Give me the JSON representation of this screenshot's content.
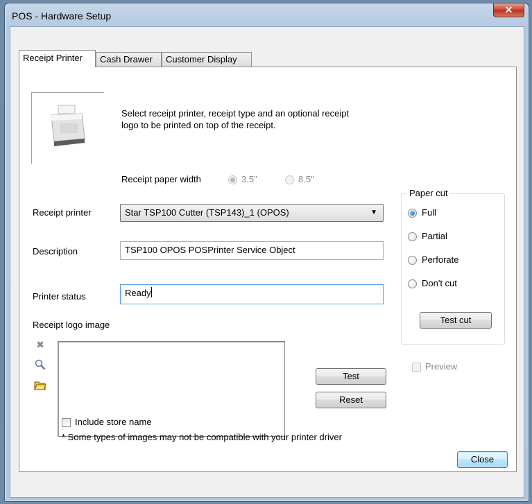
{
  "window": {
    "title": "POS - Hardware Setup",
    "close_glyph": "✕"
  },
  "tabs": [
    {
      "label": "Receipt Printer",
      "active": true
    },
    {
      "label": "Cash Drawer",
      "active": false
    },
    {
      "label": "Customer Display",
      "active": false
    }
  ],
  "intro_text_line1": "Select receipt printer, receipt type and an optional receipt",
  "intro_text_line2": "logo to be printed on top of the receipt.",
  "paper_width": {
    "label": "Receipt paper width",
    "options": [
      {
        "label": "3.5\"",
        "selected": true,
        "enabled": false
      },
      {
        "label": "8.5\"",
        "selected": false,
        "enabled": false
      }
    ]
  },
  "receipt_printer": {
    "label": "Receipt printer",
    "selected": "Star TSP100 Cutter (TSP143)_1 (OPOS)"
  },
  "description": {
    "label": "Description",
    "value": "TSP100 OPOS POSPrinter Service Object"
  },
  "printer_status": {
    "label": "Printer status",
    "value": "Ready"
  },
  "paper_cut": {
    "label": "Paper cut",
    "options": [
      {
        "label": "Full",
        "selected": true
      },
      {
        "label": "Partial",
        "selected": false
      },
      {
        "label": "Perforate",
        "selected": false
      },
      {
        "label": "Don't cut",
        "selected": false
      }
    ],
    "test_button": "Test cut"
  },
  "preview": {
    "label": "Preview",
    "checked": false,
    "enabled": false
  },
  "logo": {
    "label": "Receipt logo image",
    "icons": [
      "remove-icon",
      "magnifier-icon",
      "folder-icon"
    ],
    "test_button": "Test",
    "reset_button": "Reset",
    "include_store_name": "Include store name",
    "note": "* Some types of images may not be compatible with your printer driver"
  },
  "close_button": "Close",
  "colors": {
    "accent": "#3c7fb1",
    "title_bar": "#b9cde3",
    "close_red": "#c7452b"
  }
}
